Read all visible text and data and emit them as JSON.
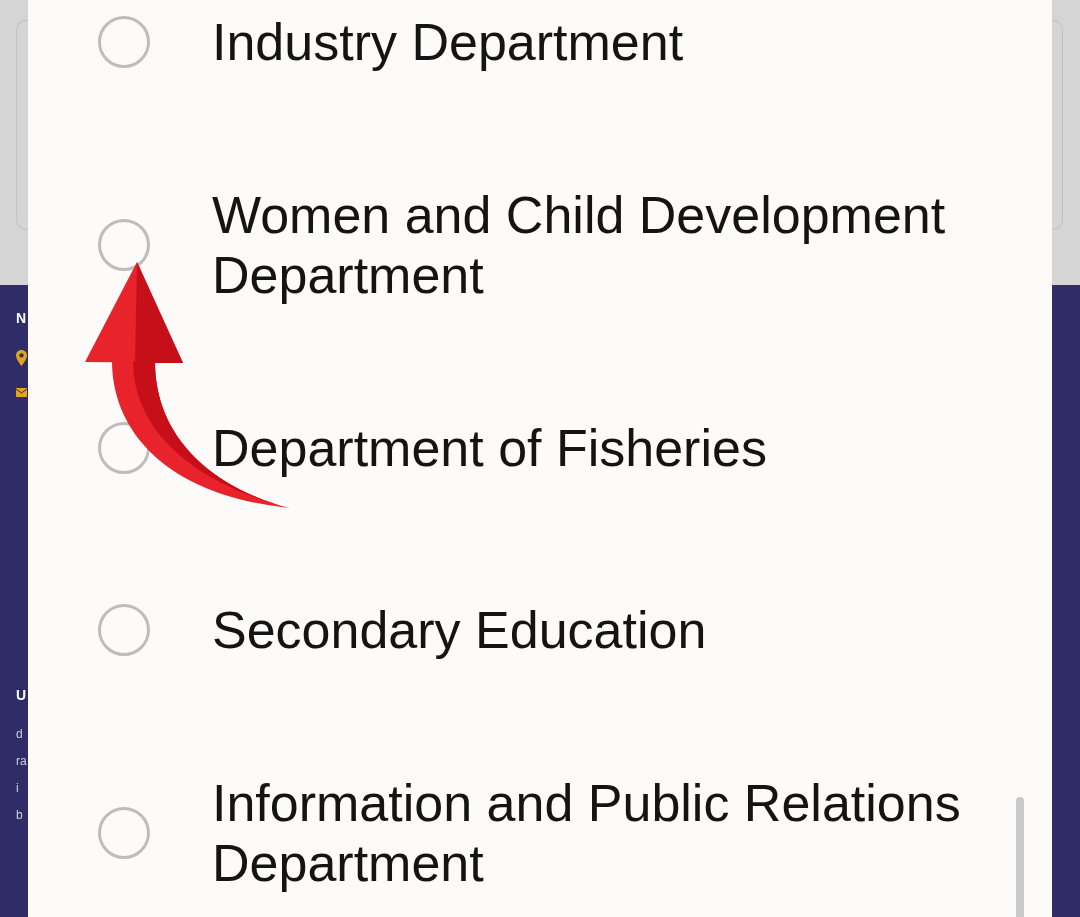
{
  "dialog": {
    "options": [
      {
        "label": "Industry Department",
        "selected": false,
        "pointed_at": false
      },
      {
        "label": "Women and Child Development Department",
        "selected": false,
        "pointed_at": true
      },
      {
        "label": "Department of Fisheries",
        "selected": false,
        "pointed_at": false
      },
      {
        "label": "Secondary Education",
        "selected": false,
        "pointed_at": false
      },
      {
        "label": "Information and Public Relations Department",
        "selected": false,
        "pointed_at": false
      }
    ]
  },
  "background_footer": {
    "section_1": {
      "heading": "N"
    },
    "section_2": {
      "heading": "U",
      "lines": [
        "d",
        "ra",
        "i",
        "b"
      ]
    }
  }
}
